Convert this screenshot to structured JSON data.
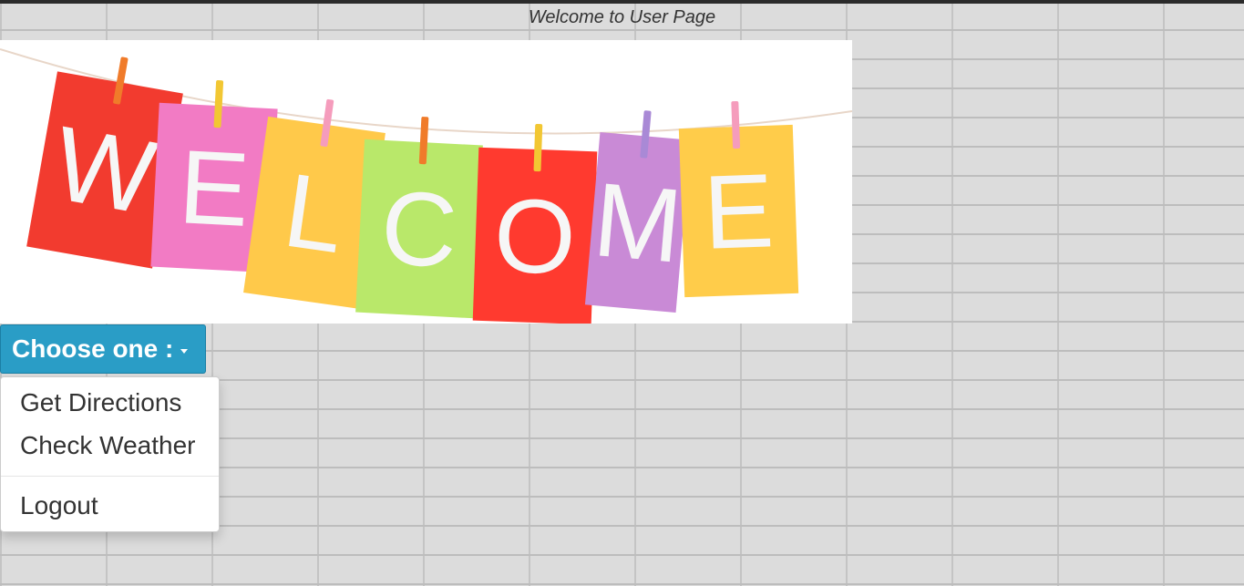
{
  "page": {
    "title": "Welcome to User Page"
  },
  "banner": {
    "letters": [
      "W",
      "E",
      "L",
      "C",
      "O",
      "M",
      "E"
    ],
    "colors": [
      "#f23b2f",
      "#f27bc4",
      "#ffc94a",
      "#b9e86a",
      "#ff3a2f",
      "#c98ad6",
      "#ffcc4a"
    ],
    "pin_colors": [
      "#f07b2a",
      "#f2c733",
      "#f59cbc",
      "#f07b2a",
      "#f2c733",
      "#a989d6",
      "#f59cbc"
    ]
  },
  "dropdown": {
    "label": "Choose one :",
    "caret_icon": "caret-down-icon"
  },
  "menu": {
    "items": [
      {
        "label": "Get Directions"
      },
      {
        "label": "Check Weather"
      },
      {
        "label": "Logout"
      }
    ]
  }
}
